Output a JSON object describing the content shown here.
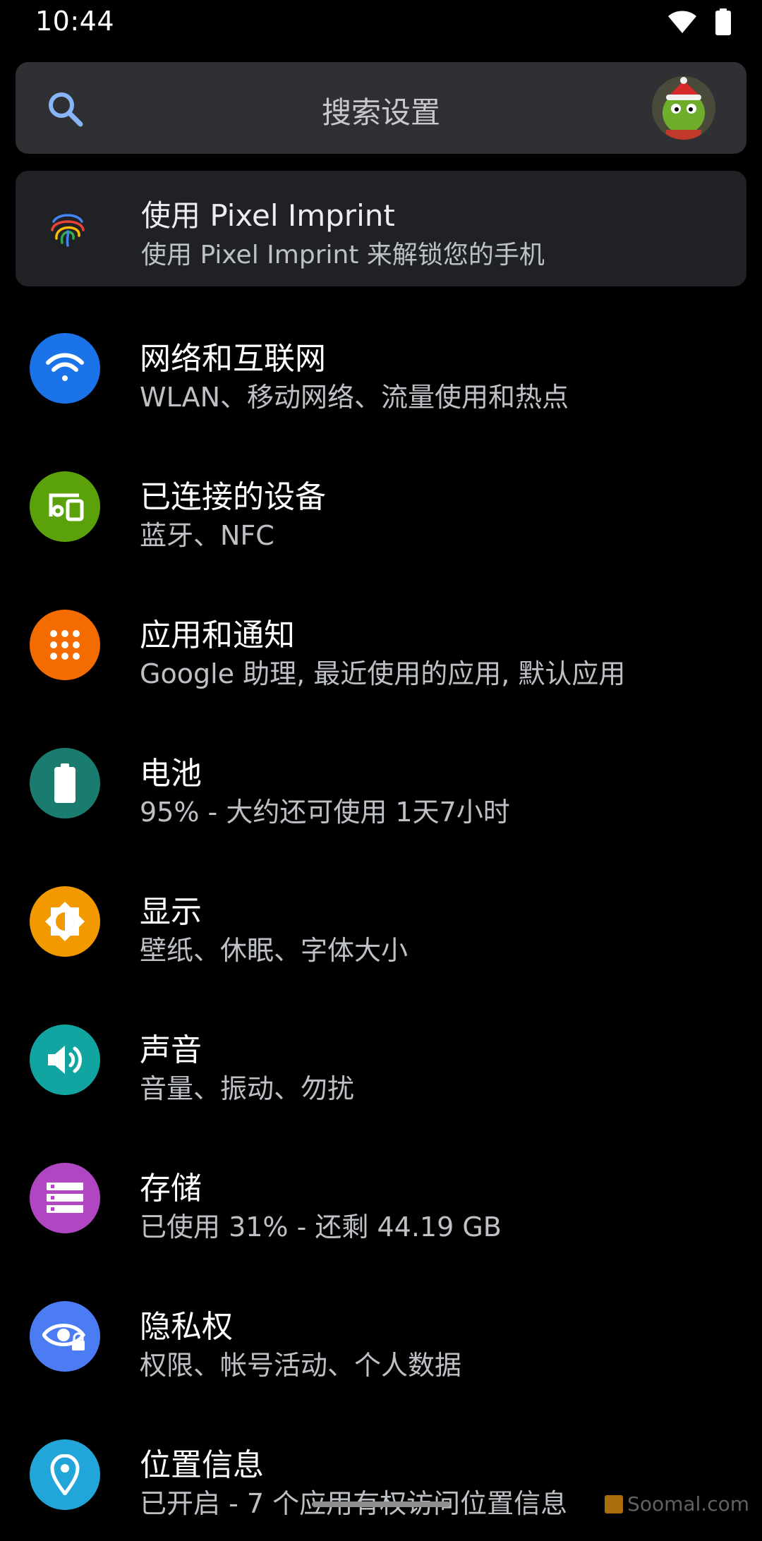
{
  "status": {
    "time": "10:44"
  },
  "search": {
    "placeholder": "搜索设置"
  },
  "suggestion": {
    "title": "使用 Pixel Imprint",
    "subtitle": "使用 Pixel Imprint 来解锁您的手机"
  },
  "items": [
    {
      "title": "网络和互联网",
      "subtitle": "WLAN、移动网络、流量使用和热点",
      "icon": "wifi-icon",
      "color": "#1a73e8"
    },
    {
      "title": "已连接的设备",
      "subtitle": "蓝牙、NFC",
      "icon": "devices-icon",
      "color": "#5aa10a"
    },
    {
      "title": "应用和通知",
      "subtitle": "Google 助理, 最近使用的应用, 默认应用",
      "icon": "apps-icon",
      "color": "#f46c00"
    },
    {
      "title": "电池",
      "subtitle": "95% - 大约还可使用 1天7小时",
      "icon": "battery-icon",
      "color": "#1a7c6f"
    },
    {
      "title": "显示",
      "subtitle": "壁纸、休眠、字体大小",
      "icon": "brightness-icon",
      "color": "#f29900"
    },
    {
      "title": "声音",
      "subtitle": "音量、振动、勿扰",
      "icon": "volume-icon",
      "color": "#12a4a0"
    },
    {
      "title": "存储",
      "subtitle": "已使用 31% - 还剩 44.19 GB",
      "icon": "storage-icon",
      "color": "#b146c2"
    },
    {
      "title": "隐私权",
      "subtitle": "权限、帐号活动、个人数据",
      "icon": "privacy-eye-icon",
      "color": "#4c7cf3"
    },
    {
      "title": "位置信息",
      "subtitle": "已开启 - 7 个应用有权访问位置信息",
      "icon": "location-pin-icon",
      "color": "#22a5d8"
    }
  ],
  "watermark": {
    "text": "Soomal.com"
  }
}
